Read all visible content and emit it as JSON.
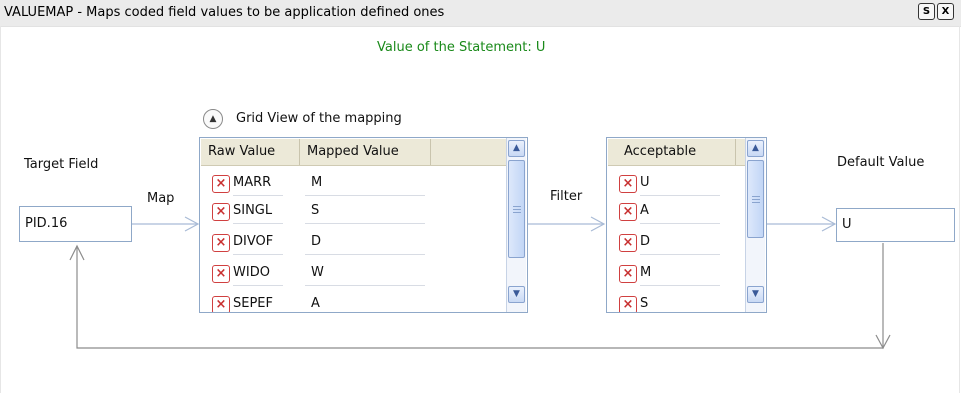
{
  "window": {
    "title": "VALUEMAP - Maps coded field values to be application defined ones",
    "btn_s": "S",
    "btn_x": "X"
  },
  "statement": "Value of the Statement: U",
  "labels": {
    "target_field": "Target Field",
    "map": "Map",
    "filter": "Filter",
    "default_value": "Default Value",
    "grid_view": "Grid View of the mapping"
  },
  "target_field_value": "PID.16",
  "default_value": "U",
  "mapping_table": {
    "columns": [
      "Raw Value",
      "Mapped Value"
    ],
    "rows": [
      {
        "raw": "MARR",
        "mapped": "M"
      },
      {
        "raw": "SINGL",
        "mapped": "S"
      },
      {
        "raw": "DIVOF",
        "mapped": "D"
      },
      {
        "raw": "WIDO",
        "mapped": "W"
      },
      {
        "raw": "SEPEF",
        "mapped": "A"
      }
    ]
  },
  "filter_table": {
    "column": "Acceptable",
    "rows": [
      "U",
      "A",
      "D",
      "M",
      "S"
    ]
  },
  "icons": {
    "remove_row": "close-x-icon",
    "collapse": "chevron-up-icon",
    "scroll_up": "arrow-up-icon",
    "scroll_down": "arrow-down-icon"
  },
  "colors": {
    "statement": "#1a8a1a",
    "remove": "#d04040",
    "panel_border": "#8fa8c8",
    "header_bg": "#ece9d8"
  }
}
